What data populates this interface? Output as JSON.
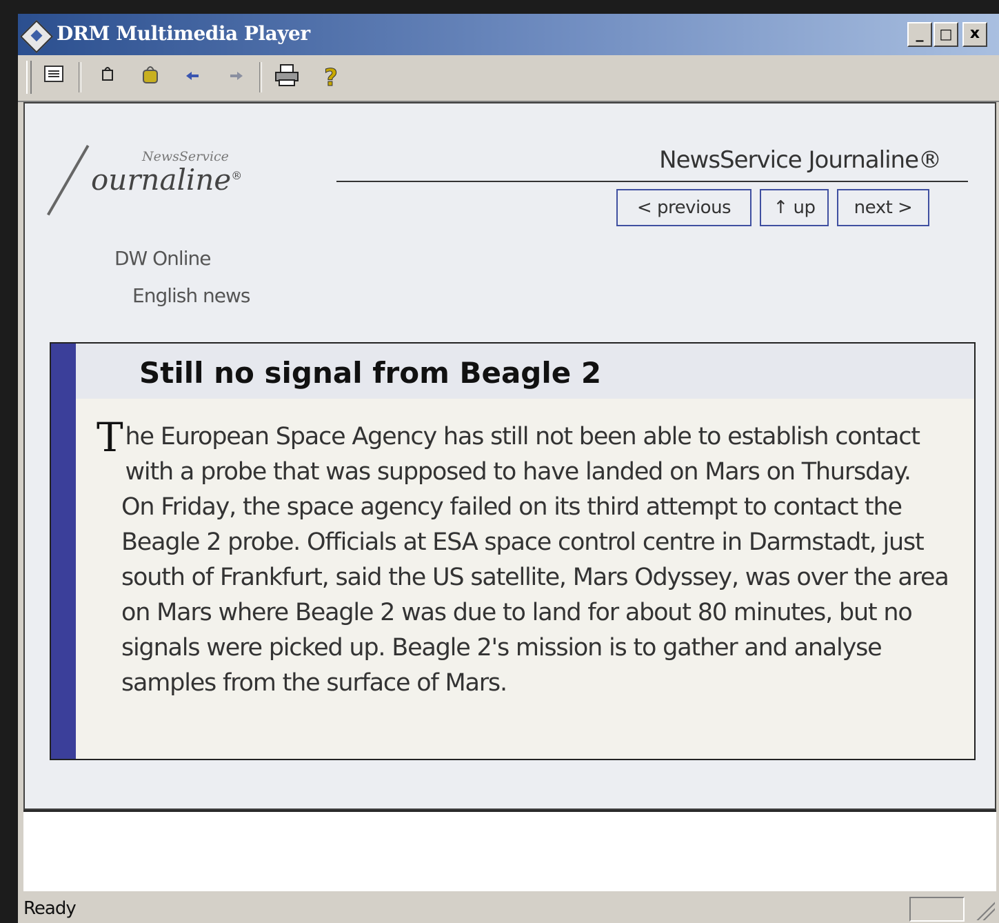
{
  "window": {
    "title": "DRM Multimedia Player"
  },
  "title_buttons": {
    "minimize": "_",
    "maximize": "□",
    "close": "x"
  },
  "toolbar": {
    "icons": [
      "list-icon",
      "home-icon",
      "bag-icon",
      "back-arrow-icon",
      "forward-arrow-icon",
      "print-icon",
      "help-icon"
    ]
  },
  "logo": {
    "small": "NewsService",
    "big": "ournaline",
    "mark": "®"
  },
  "header": {
    "title": "NewsService Journaline®"
  },
  "nav": {
    "previous": "< previous",
    "up": "↑ up",
    "next": "next >"
  },
  "breadcrumb": {
    "level1": "DW Online",
    "level2": "English news"
  },
  "article": {
    "headline": "Still no signal from Beagle 2",
    "dropcap": "T",
    "body": "he European Space Agency has still not been able to establish contact with a probe that was supposed to have landed on Mars on Thursday. On Friday, the space agency failed on its third attempt to contact the Beagle 2 probe. Officials at ESA space control centre in Darmstadt, just south of Frankfurt, said the US satellite, Mars Odyssey, was over the area on Mars where Beagle 2 was due to land for about 80 minutes, but no signals were picked up. Beagle 2's mission is to gather and analyse samples from the surface of Mars."
  },
  "status": {
    "text": "Ready"
  },
  "colors": {
    "accent_bar": "#3b3f9a",
    "titlebar_start": "#2b4f8f",
    "nav_border": "#3f4fa0"
  }
}
